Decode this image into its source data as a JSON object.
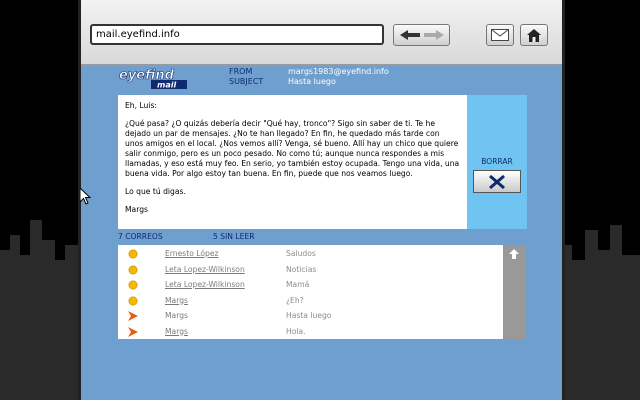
{
  "browser": {
    "url": "mail.eyefind.info"
  },
  "header": {
    "logo_top": "eyefind",
    "logo_bottom": "mail",
    "from_label": "FROM",
    "from_value": "margs1983@eyefind.info",
    "subject_label": "SUBJECT",
    "subject_value": "Hasta luego"
  },
  "message": {
    "greeting": "Eh, Luis:",
    "body": "¿Qué pasa? ¿O quizás debería decir \"Qué hay, tronco\"? Sigo sin saber de ti. Te he dejado un par de mensajes. ¿No te han llegado? En fin, he quedado más tarde con unos amigos en el local. ¿Nos vemos allí? Venga, sé bueno. Allí hay un chico que quiere salir conmigo, pero es un poco pesado. No como tú; aunque nunca respondes a mis llamadas, y eso está muy feo. En serio, yo también estoy ocupada. Tengo una vida, una buena vida. Por algo estoy tan buena. En fin, puede que nos veamos luego.",
    "closing": "Lo que tú digas.",
    "signature": "Margs"
  },
  "delete": {
    "label": "BORRAR"
  },
  "counts": {
    "total": "7 CORREOS",
    "unread": "5 SIN LEER"
  },
  "inbox": [
    {
      "status": "unread",
      "from": "Ernesto López",
      "subject": "Saludos"
    },
    {
      "status": "unread",
      "from": "Leta Lopez-Wilkinson",
      "subject": "Noticias"
    },
    {
      "status": "unread",
      "from": "Leta Lopez-Wilkinson",
      "subject": "Mamá"
    },
    {
      "status": "unread",
      "from": "Margs",
      "subject": "¿Eh?"
    },
    {
      "status": "read",
      "from": "Margs",
      "subject": "Hasta luego"
    },
    {
      "status": "read",
      "from": "Margs",
      "subject": "Hola."
    }
  ],
  "colors": {
    "page_bg": "#6f9fcf",
    "label_blue": "#0d2b6e",
    "unread_dot": "#f5b800",
    "read_arrow": "#e85a10",
    "delete_panel": "#6fc4f2"
  }
}
